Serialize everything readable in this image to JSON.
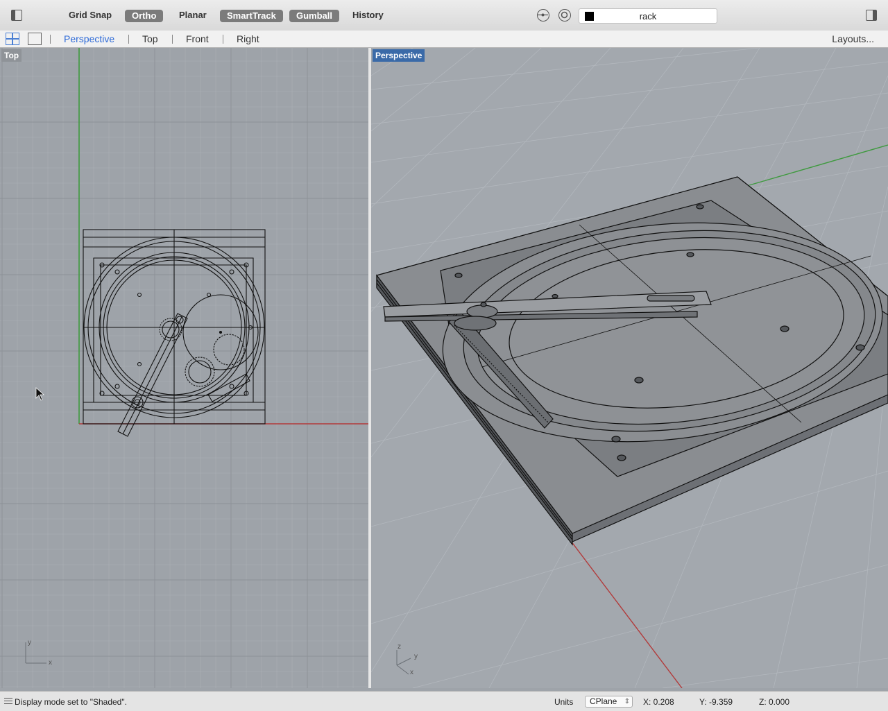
{
  "toolbar": {
    "grid_snap": "Grid Snap",
    "ortho": "Ortho",
    "planar": "Planar",
    "smarttrack": "SmartTrack",
    "gumball": "Gumball",
    "history": "History",
    "layer_name": "rack",
    "layer_color": "#000000",
    "active_toggle_color": "#7b7b7b"
  },
  "tabs": {
    "items": [
      "Perspective",
      "Top",
      "Front",
      "Right"
    ],
    "active": "Perspective",
    "layouts": "Layouts...",
    "accent_color": "#2d6ad8"
  },
  "viewports": {
    "left": {
      "label": "Top"
    },
    "right": {
      "label": "Perspective"
    },
    "left_axes": {
      "y": "y",
      "x": "x"
    },
    "right_axes": {
      "z": "z",
      "y": "y",
      "x": "x"
    }
  },
  "statusbar": {
    "message": "Display mode set to \"Shaded\".",
    "units": "Units",
    "cplane": "CPlane",
    "x": "X: 0.208",
    "y": "Y: -9.359",
    "z": "Z: 0.000"
  }
}
